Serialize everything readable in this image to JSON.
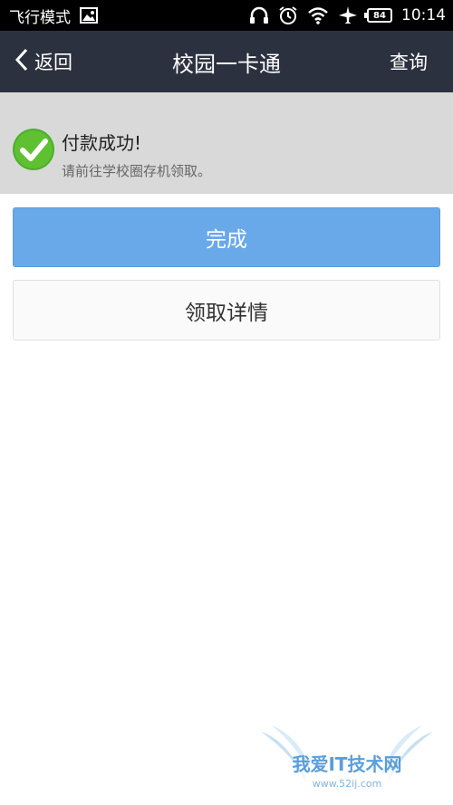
{
  "status_bar": {
    "mode_text": "飞行模式",
    "battery_level": "84",
    "time": "10:14",
    "icons": [
      "image-icon",
      "headphones-icon",
      "alarm-icon",
      "wifi-icon",
      "airplane-icon",
      "battery-icon"
    ]
  },
  "nav": {
    "back_label": "返回",
    "title": "校园一卡通",
    "action_label": "查询"
  },
  "result": {
    "title": "付款成功!",
    "subtitle": "请前往学校圈存机领取。",
    "icon": "check-circle-icon",
    "color": "#4caf2a"
  },
  "buttons": {
    "done_label": "完成",
    "detail_label": "领取详情",
    "primary_color": "#69a9ea"
  },
  "watermark": {
    "text": "我爱IT技术网",
    "url": "www.52ij.com"
  }
}
